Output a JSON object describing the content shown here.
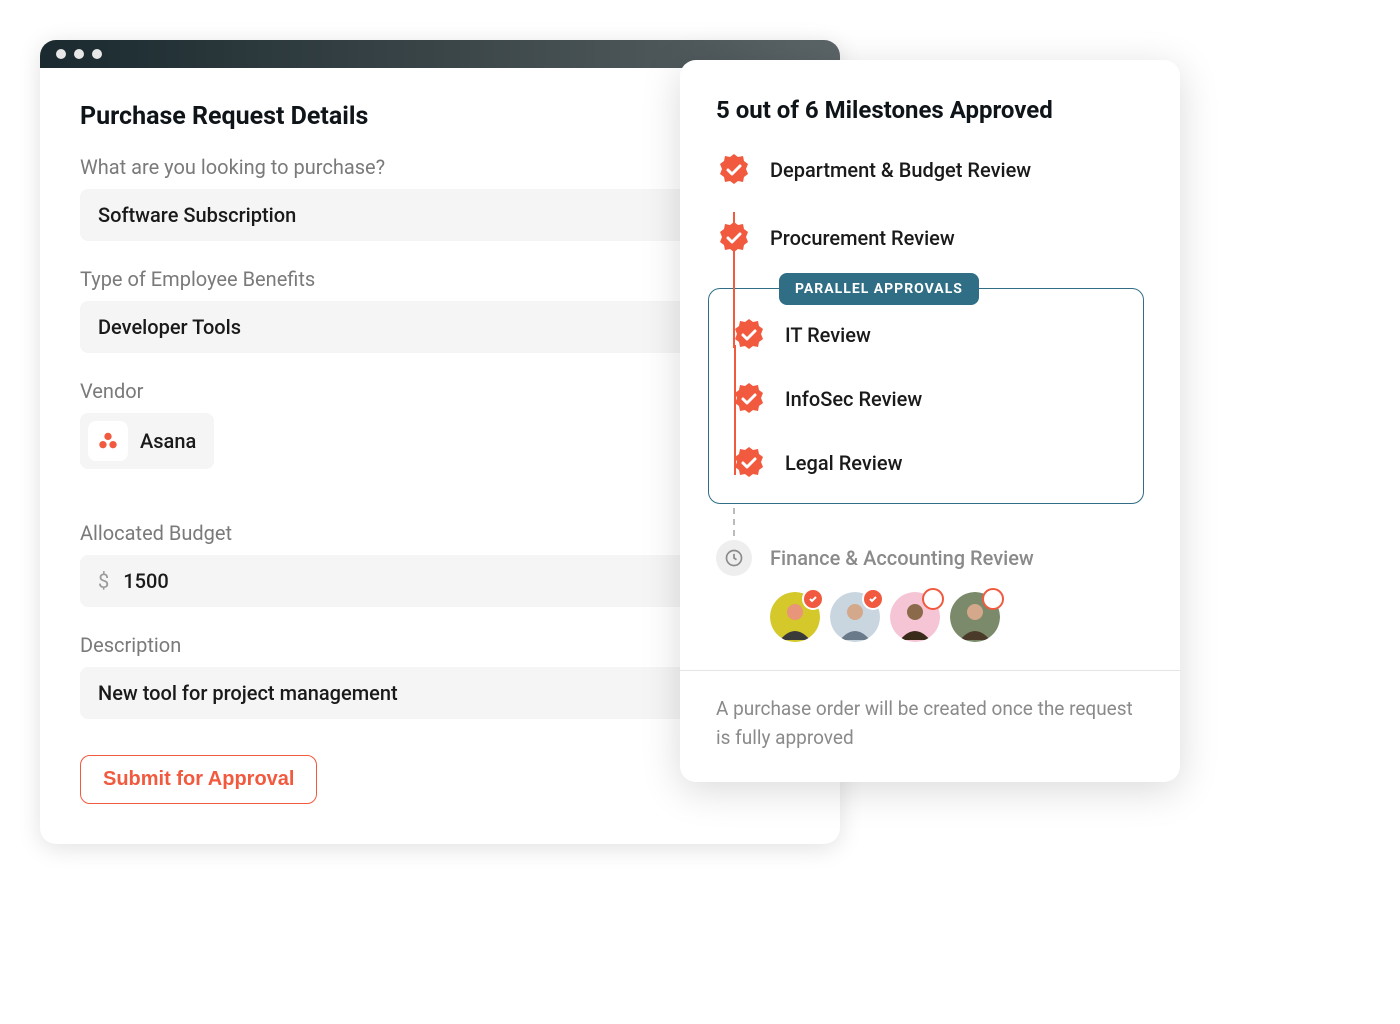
{
  "form": {
    "title": "Purchase Request Details",
    "fields": {
      "purchase_label": "What are you looking to purchase?",
      "purchase_value": "Software Subscription",
      "benefits_label": "Type of Employee Benefits",
      "benefits_value": "Developer Tools",
      "vendor_label": "Vendor",
      "vendor_value": "Asana",
      "budget_label": "Allocated Budget",
      "budget_currency": "$",
      "budget_value": "1500",
      "description_label": "Description",
      "description_value": "New tool for project management"
    },
    "submit_label": "Submit for Approval"
  },
  "milestones": {
    "title": "5 out of 6 Milestones Approved",
    "items": {
      "dept": "Department & Budget Review",
      "procurement": "Procurement Review",
      "parallel_label": "PARALLEL APPROVALS",
      "it": "IT Review",
      "infosec": "InfoSec Review",
      "legal": "Legal Review",
      "finance": "Finance & Accounting Review"
    },
    "footer_note": "A purchase order will be created once the request is fully approved",
    "approvers": [
      {
        "status": "approved",
        "bg": "#d4c82a"
      },
      {
        "status": "approved",
        "bg": "#c9d6e0"
      },
      {
        "status": "pending",
        "bg": "#f5c5d5"
      },
      {
        "status": "pending",
        "bg": "#7a8a6a"
      }
    ]
  },
  "colors": {
    "accent": "#f15a3e",
    "teal": "#2f6e85"
  }
}
